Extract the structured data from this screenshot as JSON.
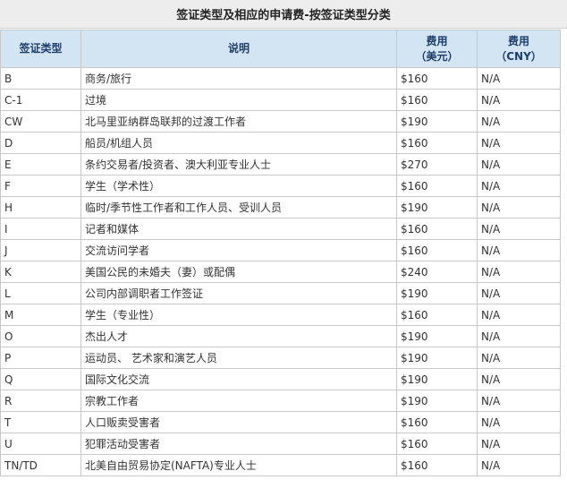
{
  "caption": "签证类型及相应的申请费-按签证类型分类",
  "headers": {
    "type": "签证类型",
    "desc": "说明",
    "usd_line1": "费用",
    "usd_line2": "（美元）",
    "cny_line1": "费用",
    "cny_line2": "（CNY）"
  },
  "rows": [
    {
      "type": "B",
      "desc": "商务/旅行",
      "usd": "$160",
      "cny": "N/A"
    },
    {
      "type": "C-1",
      "desc": "过境",
      "usd": "$160",
      "cny": "N/A"
    },
    {
      "type": "CW",
      "desc": "北马里亚纳群岛联邦的过渡工作者",
      "usd": "$190",
      "cny": "N/A"
    },
    {
      "type": "D",
      "desc": "船员/机组人员",
      "usd": "$160",
      "cny": "N/A"
    },
    {
      "type": "E",
      "desc": "条约交易者/投资者、澳大利亚专业人士",
      "usd": "$270",
      "cny": "N/A"
    },
    {
      "type": "F",
      "desc": "学生（学术性）",
      "usd": "$160",
      "cny": "N/A"
    },
    {
      "type": "H",
      "desc": "临时/季节性工作者和工作人员、受训人员",
      "usd": "$190",
      "cny": "N/A"
    },
    {
      "type": "I",
      "desc": "记者和媒体",
      "usd": "$160",
      "cny": "N/A"
    },
    {
      "type": "J",
      "desc": "交流访问学者",
      "usd": "$160",
      "cny": "N/A"
    },
    {
      "type": "K",
      "desc": "美国公民的未婚夫（妻）或配偶",
      "usd": "$240",
      "cny": "N/A"
    },
    {
      "type": "L",
      "desc": "公司内部调职者工作签证",
      "usd": "$190",
      "cny": "N/A"
    },
    {
      "type": "M",
      "desc": "学生（专业性）",
      "usd": "$160",
      "cny": "N/A"
    },
    {
      "type": "O",
      "desc": "杰出人才",
      "usd": "$190",
      "cny": "N/A"
    },
    {
      "type": "P",
      "desc": "运动员、 艺术家和演艺人员",
      "usd": "$190",
      "cny": "N/A"
    },
    {
      "type": "Q",
      "desc": "国际文化交流",
      "usd": "$190",
      "cny": "N/A"
    },
    {
      "type": "R",
      "desc": "宗教工作者",
      "usd": "$190",
      "cny": "N/A"
    },
    {
      "type": "T",
      "desc": "人口贩卖受害者",
      "usd": "$160",
      "cny": "N/A"
    },
    {
      "type": "U",
      "desc": "犯罪活动受害者",
      "usd": "$160",
      "cny": "N/A"
    },
    {
      "type": "TN/TD",
      "desc": "北美自由贸易协定(NAFTA)专业人士",
      "usd": "$160",
      "cny": "N/A"
    }
  ]
}
